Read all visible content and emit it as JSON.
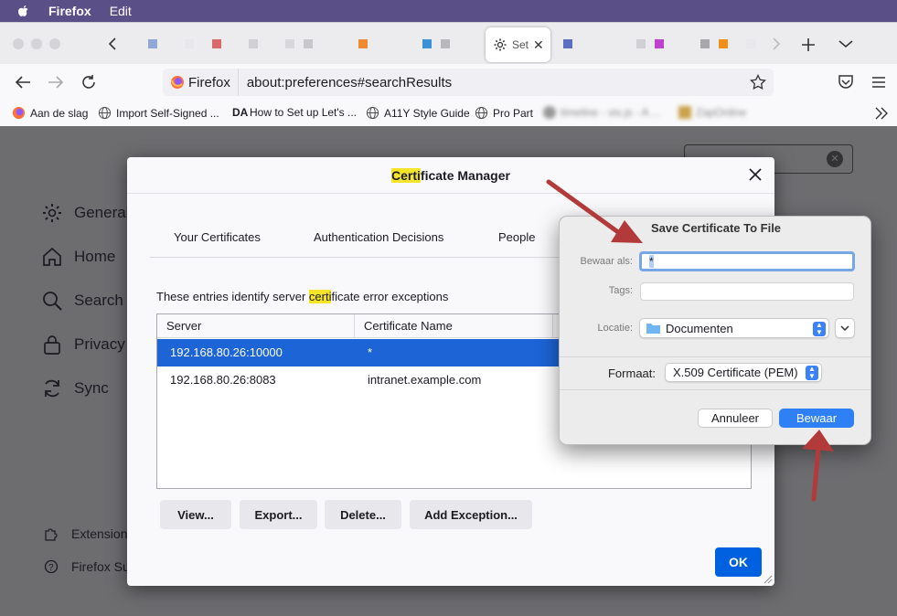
{
  "menubar": {
    "app": "Firefox",
    "menu_edit": "Edit"
  },
  "tabs": {
    "active_label": "Set",
    "favicon_colors": [
      "#8fa8d8",
      "#e8e8ec",
      "#d86a6a",
      "#d0d0d4",
      "#d8d8dc",
      "#c8c8cc",
      "#f08a30",
      "#3d90d6",
      "#b8b8bc",
      "#5a6fc0",
      "#d0d0d4",
      "#c040d0",
      "#a8a8ac",
      "#f0901a",
      "#e8e8ec"
    ]
  },
  "navbar": {
    "identity_label": "Firefox",
    "url": "about:preferences#searchResults"
  },
  "bookmarks": {
    "items": [
      "Aan de slag",
      "Import Self-Signed ...",
      "How to Set up Let's ...",
      "A11Y Style Guide",
      "Pro Part",
      "timeline - vis.js - A ...",
      "ZapOnline"
    ],
    "da_label": "DA"
  },
  "prefs_nav": {
    "items": [
      "General",
      "Home",
      "Search",
      "Privacy",
      "Sync"
    ],
    "footer": [
      "Extension",
      "Firefox Su"
    ]
  },
  "cert_manager": {
    "title_highlight": "Certi",
    "title_rest": "ficate Manager",
    "tabs": [
      "Your Certificates",
      "Authentication Decisions",
      "People"
    ],
    "desc_before": "These entries identify server ",
    "desc_highlight": "certi",
    "desc_after": "ficate error exceptions",
    "columns": [
      "Server",
      "Certificate Name"
    ],
    "rows": [
      {
        "server": "192.168.80.26:10000",
        "name": "*",
        "selected": true
      },
      {
        "server": "192.168.80.26:8083",
        "name": "intranet.example.com",
        "selected": false
      }
    ],
    "buttons": [
      "View...",
      "Export...",
      "Delete...",
      "Add Exception..."
    ],
    "ok": "OK"
  },
  "save_dialog": {
    "title": "Save Certificate To File",
    "save_as_label": "Bewaar als:",
    "save_as_value": "*",
    "tags_label": "Tags:",
    "location_label": "Locatie:",
    "location_value": "Documenten",
    "format_label": "Formaat:",
    "format_value": "X.509 Certificate (PEM)",
    "cancel": "Annuleer",
    "save": "Bewaar"
  },
  "colors": {
    "accent": "#0061e0",
    "selection": "#1d64d6",
    "annotation_arrow": "#b23a3a",
    "highlight": "#f4e52b"
  }
}
